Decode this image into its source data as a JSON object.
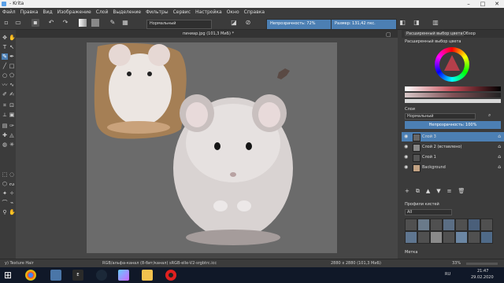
{
  "window": {
    "title": "- Krita"
  },
  "menu": [
    "Файл",
    "Правка",
    "Вид",
    "Изображение",
    "Слой",
    "Выделение",
    "Фильтры",
    "Сервис",
    "Настройка",
    "Окно",
    "Справка"
  ],
  "toolbar": {
    "blend_mode": "Нормальный",
    "opacity_label": "Непрозрачность: 72%",
    "opacity_value": 72,
    "size_label": "Размер: 131,42 пкс."
  },
  "document": {
    "tab": "пиниар.jpg (101,3 МиБ) *"
  },
  "dock": {
    "tab_color": "Расширенный выбор цвета",
    "tab_overview": "Обзор",
    "color_title": "Расширенный выбор цвета",
    "layers_title": "Слои",
    "layer_blend": "Нормальный",
    "layer_opacity": "Непрозрачность: 100%",
    "layers": [
      {
        "name": "Слой 3",
        "active": true
      },
      {
        "name": "Слой 2 (вставлено)",
        "active": false
      },
      {
        "name": "Слой 1",
        "active": false
      },
      {
        "name": "Background",
        "active": false
      }
    ],
    "brush_presets_title": "Профили кистей",
    "brush_filter": "All",
    "brush_tag_label": "Метка"
  },
  "status": {
    "brush": "y) Texture Hair",
    "colorspace": "RGB/альфа-канал (8-бит/канал) sRGB-elle-V2-srgbtrc.icc",
    "dimensions": "2880 x 2880 (101,3 МиБ)",
    "zoom": "33%"
  },
  "taskbar": {
    "lang": "RU",
    "time": "21:47",
    "date": "29.02.2020"
  },
  "colors": {
    "accent": "#4c7fb3",
    "panel": "#3b3b3b",
    "canvas": "#6b6b6b"
  }
}
